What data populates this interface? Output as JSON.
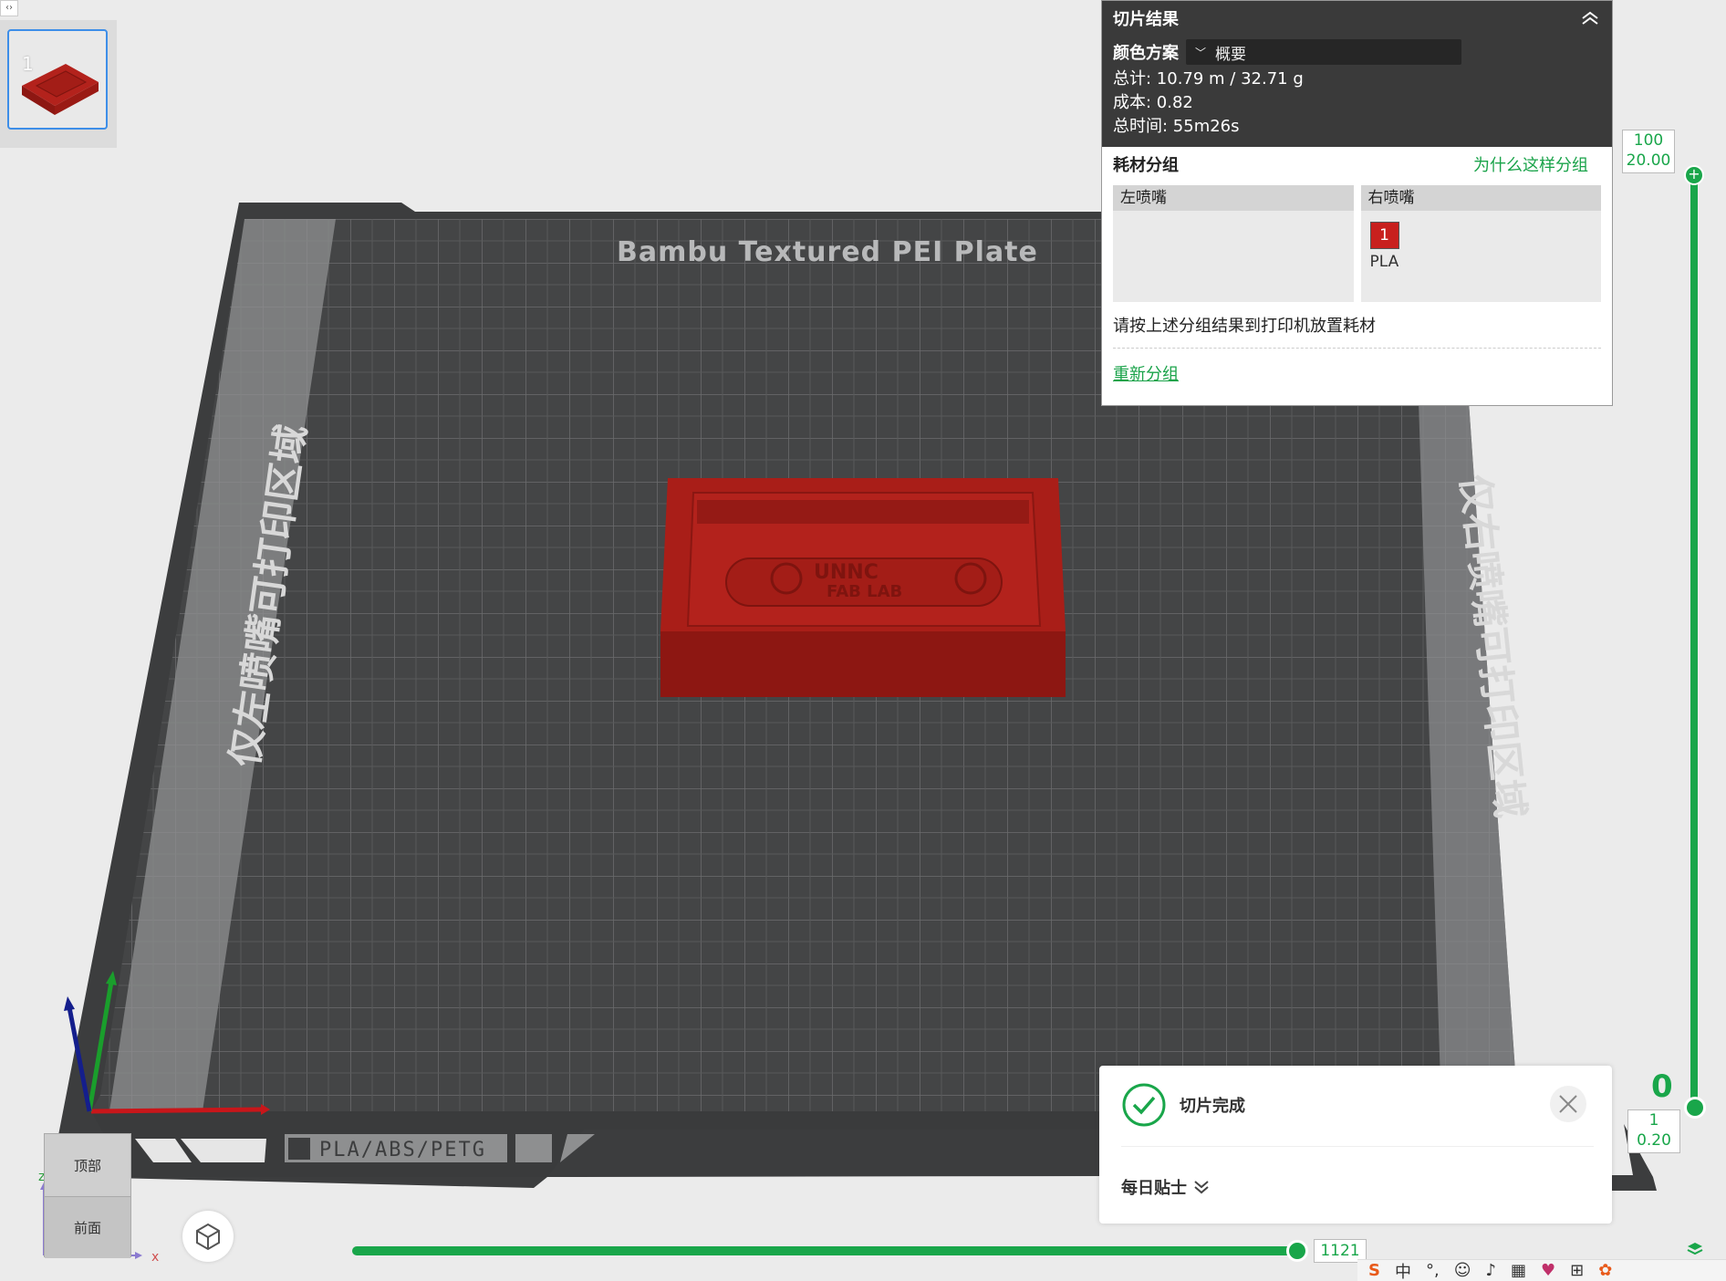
{
  "plate": {
    "thumbnail_number": "1",
    "bed_label": "Bambu Textured PEI Plate",
    "left_zone_label": "仅左喷嘴可打印区域",
    "right_zone_label": "仅右喷嘴可打印区域",
    "material_label": "PLA/ABS/PETG",
    "model_text_line1": "UNNC",
    "model_text_line2": "FAB LAB",
    "model_color": "#b3221c"
  },
  "result": {
    "title": "切片结果",
    "scheme_label": "颜色方案",
    "scheme_value": "概要",
    "total": "总计:  10.79 m / 32.71 g",
    "cost": "成本:  0.82",
    "time": "总时间:  55m26s",
    "group_title": "耗材分组",
    "why_link": "为什么这样分组",
    "left_nozzle": "左喷嘴",
    "right_nozzle": "右喷嘴",
    "filament_slot": "1",
    "filament_name": "PLA",
    "filament_color": "#c8201e",
    "hint": "请按上述分组结果到打印机放置耗材",
    "regroup": "重新分组"
  },
  "layer_slider": {
    "top_layer": "100",
    "top_height": "20.00",
    "bottom_layer": "1",
    "bottom_height": "0.20",
    "bottom_glyph": "0"
  },
  "move_slider": {
    "value": "1121"
  },
  "toast": {
    "title": "切片完成",
    "tips": "每日贴士"
  },
  "view": {
    "top": "顶部",
    "front": "前面",
    "axis_x": "x",
    "axis_z": "z"
  },
  "taskbar": {
    "ime": "中"
  },
  "colors": {
    "accent": "#19a64a",
    "bed": "#444546",
    "panel_dark": "#3a3a3a"
  }
}
